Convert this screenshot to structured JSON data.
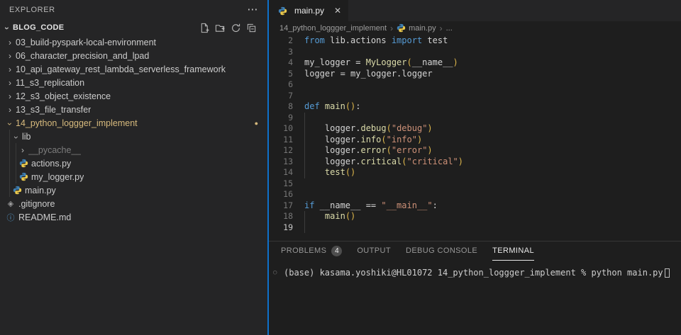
{
  "colors": {
    "sash_accent": "#0e70c9",
    "git_modified": "#d7ba7d",
    "git_ignored": "#7d7d7d",
    "keyword": "#569cd6",
    "string": "#ce9178",
    "function": "#dcdcaa",
    "bracket": "#ddb64b"
  },
  "icons": {
    "more": "⋯",
    "close": "✕",
    "chevron": "›",
    "breadcrumb_sep": "›",
    "git_dot": "●",
    "terminal_circle": "○",
    "gitignore_glyph": "◈",
    "readme_glyph": "ⓘ"
  },
  "sidebar": {
    "title": "EXPLORER",
    "section": "BLOG_CODE",
    "actions": [
      {
        "name": "new-file"
      },
      {
        "name": "new-folder"
      },
      {
        "name": "refresh"
      },
      {
        "name": "collapse-all"
      }
    ],
    "tree": [
      {
        "label": "03_build-pyspark-local-environment",
        "level": 0,
        "type": "folder",
        "state": "collapsed"
      },
      {
        "label": "06_character_precision_and_lpad",
        "level": 0,
        "type": "folder",
        "state": "collapsed"
      },
      {
        "label": "10_api_gateway_rest_lambda_serverless_framework",
        "level": 0,
        "type": "folder",
        "state": "collapsed"
      },
      {
        "label": "11_s3_replication",
        "level": 0,
        "type": "folder",
        "state": "collapsed"
      },
      {
        "label": "12_s3_object_existence",
        "level": 0,
        "type": "folder",
        "state": "collapsed"
      },
      {
        "label": "13_s3_file_transfer",
        "level": 0,
        "type": "folder",
        "state": "collapsed"
      },
      {
        "label": "14_python_loggger_implement",
        "level": 0,
        "type": "folder",
        "state": "expanded",
        "git": "modified",
        "dot": true
      },
      {
        "label": "lib",
        "level": 1,
        "type": "folder",
        "state": "expanded"
      },
      {
        "label": "__pycache__",
        "level": 2,
        "type": "folder",
        "state": "collapsed",
        "git": "ignored"
      },
      {
        "label": "actions.py",
        "level": 2,
        "type": "file",
        "icon": "python"
      },
      {
        "label": "my_logger.py",
        "level": 2,
        "type": "file",
        "icon": "python"
      },
      {
        "label": "main.py",
        "level": 1,
        "type": "file",
        "icon": "python"
      },
      {
        "label": ".gitignore",
        "level": 0,
        "type": "file",
        "icon": "gitignore"
      },
      {
        "label": "README.md",
        "level": 0,
        "type": "file",
        "icon": "readme"
      }
    ]
  },
  "editor": {
    "tab": {
      "label": "main.py",
      "icon": "python"
    },
    "breadcrumb": [
      {
        "label": "14_python_loggger_implement"
      },
      {
        "label": "main.py",
        "icon": "python"
      },
      {
        "label": "..."
      }
    ],
    "lines": [
      {
        "n": 2,
        "t": [
          [
            "k",
            "from"
          ],
          [
            "t",
            " lib.actions "
          ],
          [
            "k",
            "import"
          ],
          [
            "t",
            " test"
          ]
        ]
      },
      {
        "n": 3,
        "t": []
      },
      {
        "n": 4,
        "t": [
          [
            "t",
            "my_logger = "
          ],
          [
            "f",
            "MyLogger"
          ],
          [
            "b",
            "("
          ],
          [
            "t",
            "__name__"
          ],
          [
            "b",
            ")"
          ]
        ]
      },
      {
        "n": 5,
        "t": [
          [
            "t",
            "logger = my_logger.logger"
          ]
        ]
      },
      {
        "n": 6,
        "t": []
      },
      {
        "n": 7,
        "t": []
      },
      {
        "n": 8,
        "t": [
          [
            "k",
            "def"
          ],
          [
            "t",
            " "
          ],
          [
            "f",
            "main"
          ],
          [
            "b",
            "()"
          ],
          [
            "t",
            ":"
          ]
        ]
      },
      {
        "n": 9,
        "t": [],
        "g": true
      },
      {
        "n": 10,
        "t": [
          [
            "t",
            "    logger."
          ],
          [
            "f",
            "debug"
          ],
          [
            "b",
            "("
          ],
          [
            "s",
            "\"debug\""
          ],
          [
            "b",
            ")"
          ]
        ],
        "g": true
      },
      {
        "n": 11,
        "t": [
          [
            "t",
            "    logger."
          ],
          [
            "f",
            "info"
          ],
          [
            "b",
            "("
          ],
          [
            "s",
            "\"info\""
          ],
          [
            "b",
            ")"
          ]
        ],
        "g": true
      },
      {
        "n": 12,
        "t": [
          [
            "t",
            "    logger."
          ],
          [
            "f",
            "error"
          ],
          [
            "b",
            "("
          ],
          [
            "s",
            "\"error\""
          ],
          [
            "b",
            ")"
          ]
        ],
        "g": true
      },
      {
        "n": 13,
        "t": [
          [
            "t",
            "    logger."
          ],
          [
            "f",
            "critical"
          ],
          [
            "b",
            "("
          ],
          [
            "s",
            "\"critical\""
          ],
          [
            "b",
            ")"
          ]
        ],
        "g": true
      },
      {
        "n": 14,
        "t": [
          [
            "t",
            "    "
          ],
          [
            "f",
            "test"
          ],
          [
            "b",
            "()"
          ]
        ],
        "g": true
      },
      {
        "n": 15,
        "t": []
      },
      {
        "n": 16,
        "t": []
      },
      {
        "n": 17,
        "t": [
          [
            "k",
            "if"
          ],
          [
            "t",
            " __name__ == "
          ],
          [
            "s",
            "\"__main__\""
          ],
          [
            "t",
            ":"
          ]
        ]
      },
      {
        "n": 18,
        "t": [
          [
            "t",
            "    "
          ],
          [
            "f",
            "main"
          ],
          [
            "b",
            "()"
          ]
        ],
        "g": true
      },
      {
        "n": 19,
        "t": [],
        "g": true,
        "active": true
      }
    ]
  },
  "panel": {
    "tabs": [
      {
        "label": "PROBLEMS",
        "badge": "4"
      },
      {
        "label": "OUTPUT"
      },
      {
        "label": "DEBUG CONSOLE"
      },
      {
        "label": "TERMINAL",
        "active": true
      }
    ],
    "terminal": {
      "prompt": "(base) kasama.yoshiki@HL01072 14_python_loggger_implement % python main.py"
    }
  }
}
